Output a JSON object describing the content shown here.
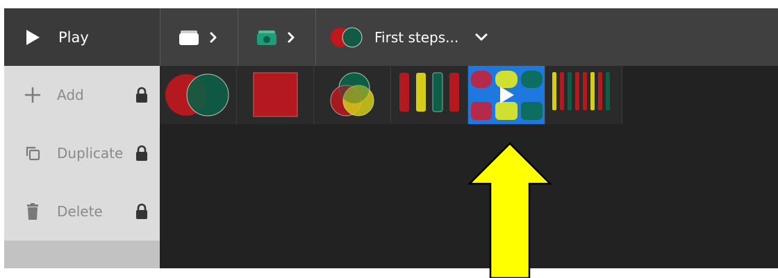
{
  "toolbar": {
    "play_label": "Play",
    "breadcrumb_title": "First steps..."
  },
  "sidebar": {
    "items": [
      {
        "label": "Add",
        "icon": "plus-icon",
        "locked": true
      },
      {
        "label": "Duplicate",
        "icon": "duplicate-icon",
        "locked": true
      },
      {
        "label": "Delete",
        "icon": "trash-icon",
        "locked": true
      }
    ]
  },
  "thumbnails": [
    {
      "name": "two-overlapping-circles"
    },
    {
      "name": "red-square"
    },
    {
      "name": "three-overlapping-circles"
    },
    {
      "name": "four-vertical-bars"
    },
    {
      "name": "rounded-tiles-grid",
      "selected": true
    },
    {
      "name": "many-vertical-bars"
    }
  ],
  "colors": {
    "red": "#b3191e",
    "green": "#0d5e46",
    "yellow": "#d4cd1a",
    "teal": "#1f8c73",
    "selected": "#1e78e0",
    "arrow": "#ffff00"
  }
}
